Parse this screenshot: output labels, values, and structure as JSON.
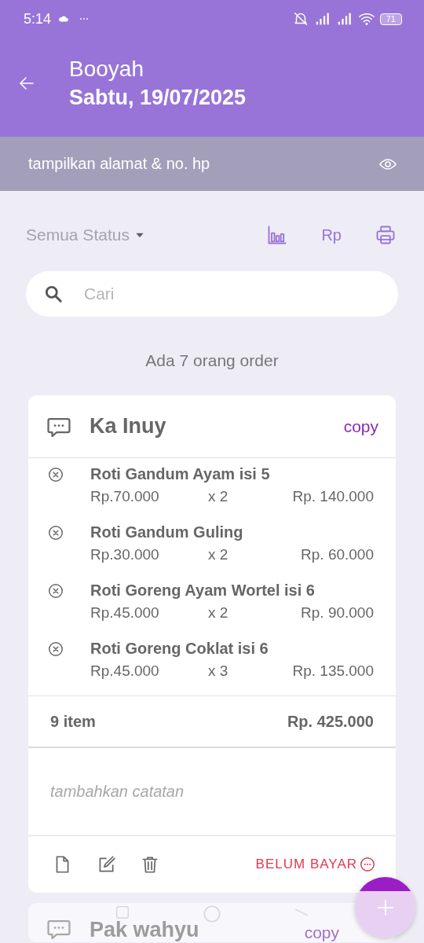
{
  "status_bar": {
    "time": "5:14",
    "battery": "71"
  },
  "header": {
    "title": "Booyah",
    "subtitle": "Sabtu, 19/07/2025"
  },
  "address_toggle": {
    "label": "tampilkan alamat & no. hp"
  },
  "toolbar": {
    "status_filter": "Semua Status",
    "currency": "Rp"
  },
  "search": {
    "placeholder": "Cari"
  },
  "summary": "Ada 7 orang order",
  "orders": [
    {
      "customer": "Ka Inuy",
      "copy": "copy",
      "items": [
        {
          "name": "Roti Gandum Ayam isi 5",
          "price": "Rp.70.000",
          "qty": "x 2",
          "subtotal": "Rp. 140.000"
        },
        {
          "name": "Roti Gandum Guling",
          "price": "Rp.30.000",
          "qty": "x 2",
          "subtotal": "Rp. 60.000"
        },
        {
          "name": "Roti Goreng Ayam Wortel isi 6",
          "price": "Rp.45.000",
          "qty": "x 2",
          "subtotal": "Rp. 90.000"
        },
        {
          "name": "Roti Goreng Coklat isi 6",
          "price": "Rp.45.000",
          "qty": "x 3",
          "subtotal": "Rp. 135.000"
        }
      ],
      "item_count": "9 item",
      "total": "Rp. 425.000",
      "note_placeholder": "tambahkan catatan",
      "payment_status": "BELUM BAYAR"
    },
    {
      "customer": "Pak wahyu",
      "copy": "copy"
    }
  ]
}
